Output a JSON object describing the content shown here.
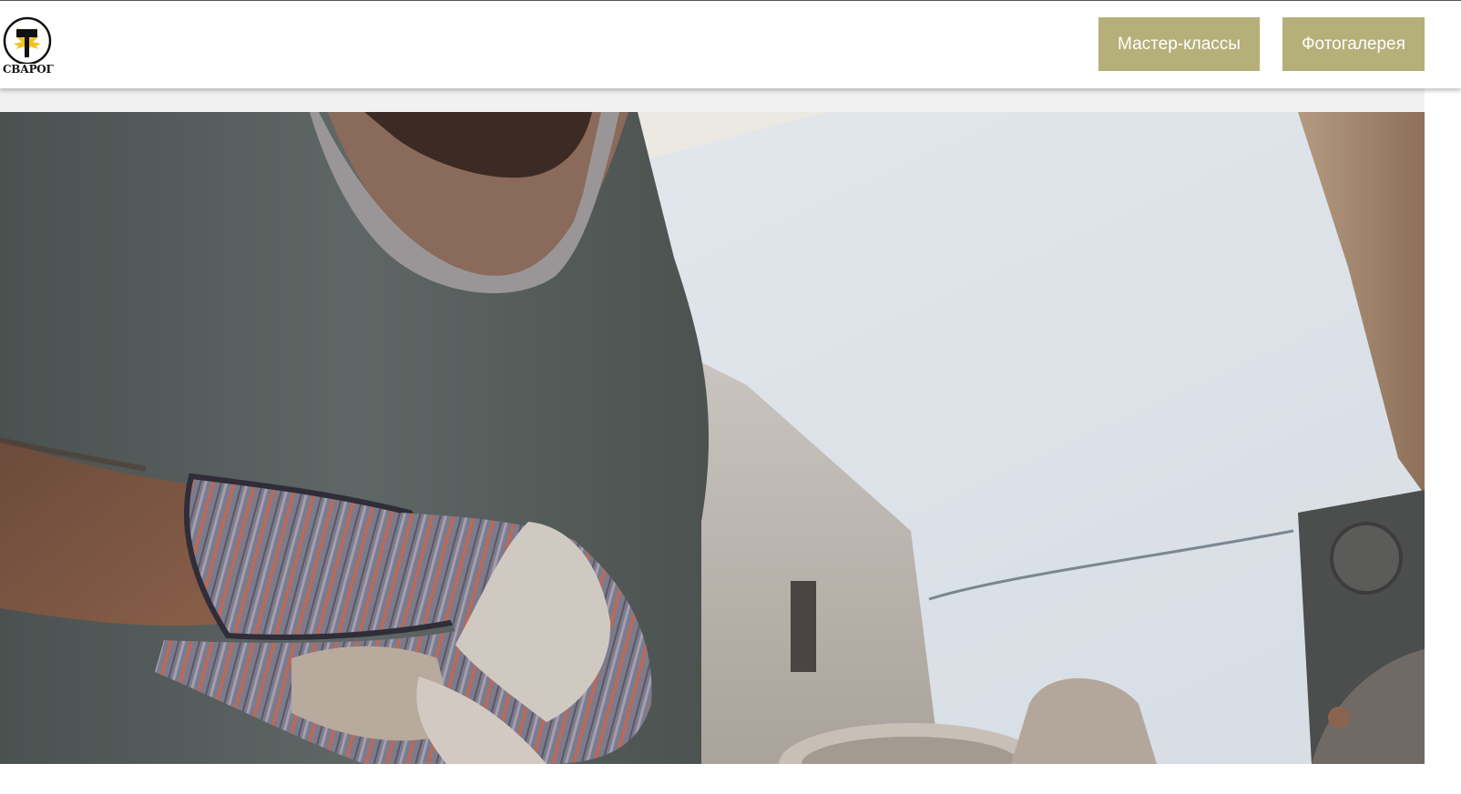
{
  "header": {
    "logo": {
      "text": "СВАРОГ",
      "icon": "hammer-sun-logo-icon",
      "colors": {
        "ring": "#111111",
        "sun": "#f3c21a",
        "hammer": "#111111"
      }
    },
    "nav": {
      "master_classes_label": "Мастер-классы",
      "gallery_label": "Фотогалерея"
    },
    "button_color": "#b5b07a"
  },
  "hero": {
    "image": "welder-photo",
    "description_icon": "worker-grinding-metal-photo"
  }
}
